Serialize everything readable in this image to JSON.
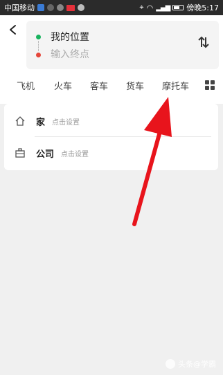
{
  "status_bar": {
    "carrier": "中国移动",
    "time": "傍晚5:17",
    "battery_color": "#ffffff"
  },
  "route": {
    "start_label": "我的位置",
    "end_placeholder": "输入终点",
    "start_dot_color": "#19b35e",
    "end_dot_color": "#e5463a"
  },
  "icons": {
    "back": "chevron-left-icon",
    "swap": "swap-vertical-icon",
    "more": "grid-icon",
    "home": "home-icon",
    "company": "briefcase-icon"
  },
  "tabs": [
    "飞机",
    "火车",
    "客车",
    "货车",
    "摩托车"
  ],
  "saved_places": [
    {
      "title": "家",
      "hint": "点击设置"
    },
    {
      "title": "公司",
      "hint": "点击设置"
    }
  ],
  "annotation": {
    "arrow_color": "#e8141c"
  },
  "watermark": {
    "text": "头条@学霸"
  }
}
